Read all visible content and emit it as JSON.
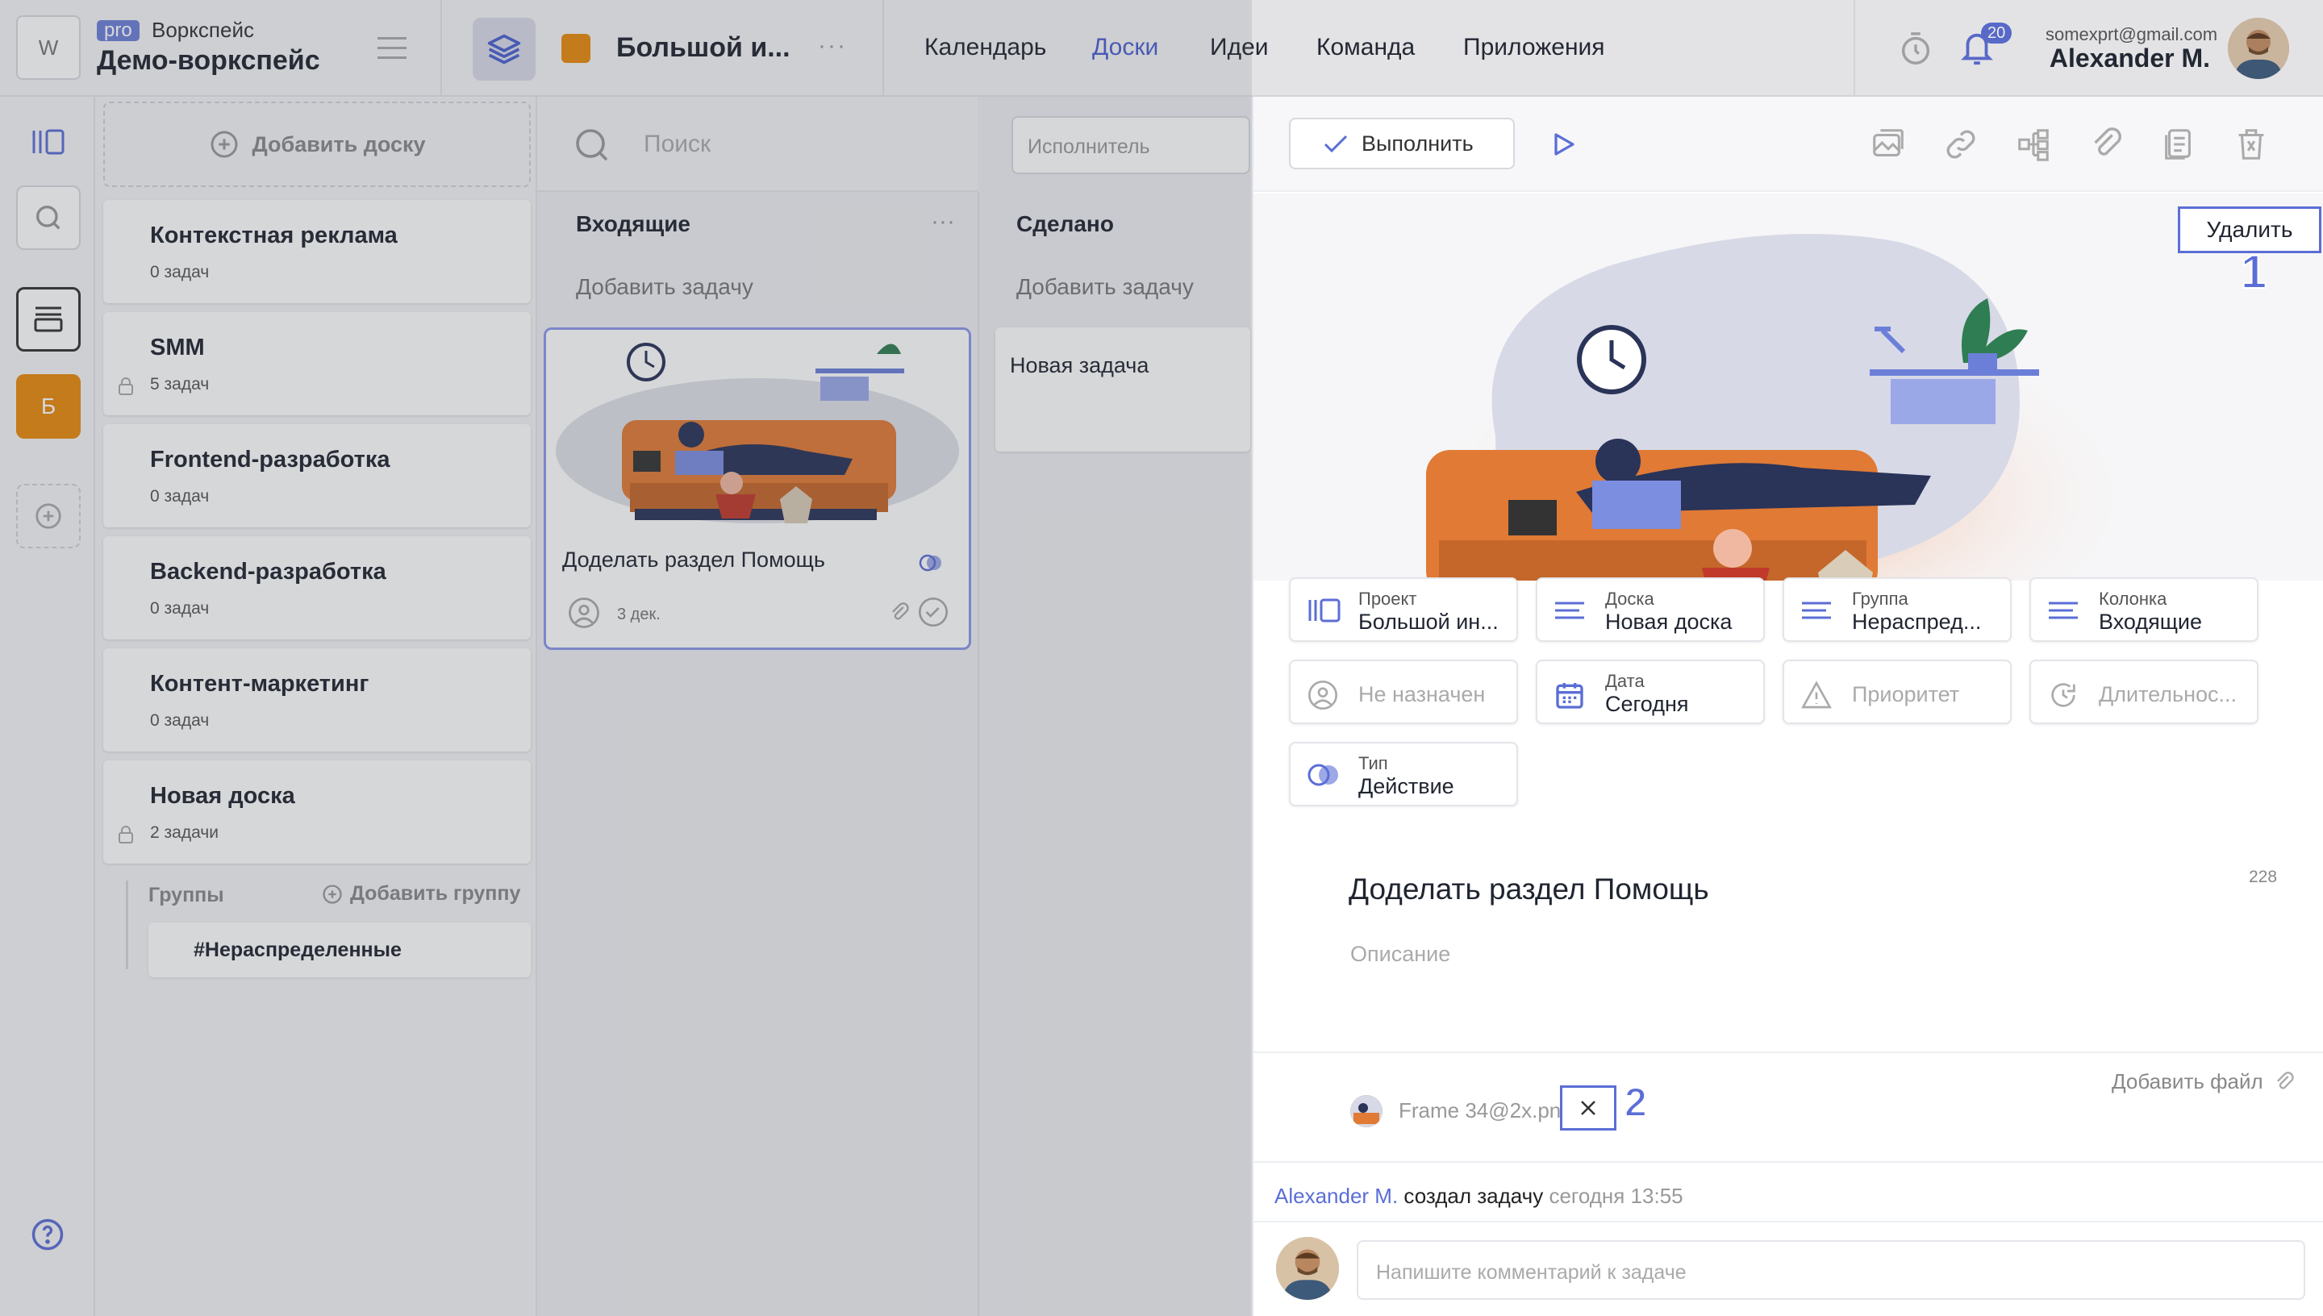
{
  "workspace": {
    "initial": "W",
    "pro_badge": "pro",
    "subtitle": "Воркспейс",
    "name": "Демо-воркспейс"
  },
  "project": {
    "title": "Большой и...",
    "more": "···",
    "color": "#e8890c"
  },
  "nav": [
    {
      "label": "Календарь"
    },
    {
      "label": "Доски",
      "active": true
    },
    {
      "label": "Идеи"
    },
    {
      "label": "Команда"
    },
    {
      "label": "Приложения"
    }
  ],
  "notifications": {
    "count": "20"
  },
  "user": {
    "email": "somexprt@gmail.com",
    "name": "Alexander M."
  },
  "rail": {
    "project_letter": "Б"
  },
  "boards": {
    "add_label": "Добавить доску",
    "items": [
      {
        "title": "Контекстная реклама",
        "count": "0 задач"
      },
      {
        "title": "SMM",
        "count": "5 задач",
        "locked": true
      },
      {
        "title": "Frontend-разработка",
        "count": "0 задач"
      },
      {
        "title": "Backend-разработка",
        "count": "0 задач"
      },
      {
        "title": "Контент-маркетинг",
        "count": "0 задач"
      },
      {
        "title": "Новая доска",
        "count": "2 задачи",
        "locked": true
      }
    ],
    "groups_label": "Группы",
    "add_group_label": "Добавить группу",
    "group_item": "#Нераспределенные"
  },
  "kanban": {
    "search_placeholder": "Поиск",
    "assignee_placeholder": "Исполнитель",
    "columns": [
      {
        "title": "Входящие",
        "add_label": "Добавить задачу"
      },
      {
        "title": "Сделано",
        "add_label": "Добавить задачу"
      }
    ],
    "task": {
      "title": "Доделать раздел Помощь",
      "date": "3 дек."
    },
    "new_task": {
      "title": "Новая задача"
    }
  },
  "detail": {
    "done_label": "Выполнить",
    "delete_label": "Удалить",
    "props": [
      {
        "label": "Проект",
        "value": "Большой ин..."
      },
      {
        "label": "Доска",
        "value": "Новая доска"
      },
      {
        "label": "Группа",
        "value": "Нераспред..."
      },
      {
        "label": "Колонка",
        "value": "Входящие"
      },
      {
        "placeholder": "Не назначен"
      },
      {
        "label": "Дата",
        "value": "Сегодня"
      },
      {
        "placeholder": "Приоритет"
      },
      {
        "placeholder": "Длительнос..."
      },
      {
        "label": "Тип",
        "value": "Действие"
      }
    ],
    "title": "Доделать раздел Помощь",
    "char_count": "228",
    "description_placeholder": "Описание",
    "add_file_label": "Добавить файл",
    "attachment": {
      "name": "Frame 34@2x.png"
    },
    "log": {
      "user": "Alexander M.",
      "action": " создал задачу ",
      "time": "сегодня 13:55"
    },
    "comment_placeholder": "Напишите комментарий к задаче"
  },
  "annotations": {
    "one": "1",
    "two": "2"
  },
  "colors": {
    "accent": "#5b6ed6",
    "project": "#e8890c",
    "sofa": "#e07a35"
  }
}
